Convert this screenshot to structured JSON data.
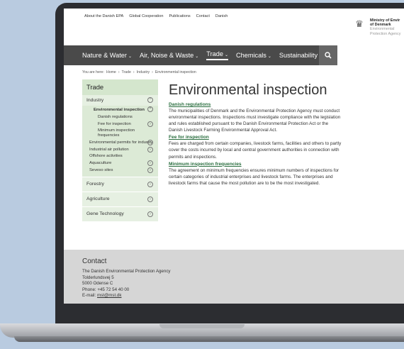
{
  "utility": {
    "links": [
      "About the Danish EPA",
      "Global Cooperation",
      "Publications",
      "Contact",
      "Danish"
    ]
  },
  "logo": {
    "line1": "Ministry of Envir",
    "line2": "of Denmark",
    "line3": "Environmental",
    "line4": "Protection Agency"
  },
  "nav": {
    "items": [
      {
        "label": "Nature & Water"
      },
      {
        "label": "Air, Noise & Waste"
      },
      {
        "label": "Trade"
      },
      {
        "label": "Chemicals"
      },
      {
        "label": "Sustainability"
      }
    ],
    "search_icon": "search-icon"
  },
  "breadcrumb": {
    "prefix": "You are here:",
    "items": [
      "Home",
      "Trade",
      "Industry",
      "Environmental inspection"
    ]
  },
  "sidebar": {
    "title": "Trade",
    "industry": "Industry",
    "sub": [
      {
        "label": "Environmental inspection"
      },
      {
        "label": "Danish regulations"
      },
      {
        "label": "Fee for inspection"
      },
      {
        "label": "Minimum inspection frequencies"
      },
      {
        "label": "Environmental permits for industry"
      },
      {
        "label": "Industrial air pollution"
      },
      {
        "label": "Offshore activities"
      },
      {
        "label": "Aquaculture"
      },
      {
        "label": "Seveso sites"
      }
    ],
    "sections": [
      "Forestry",
      "Agriculture",
      "Gene Technology"
    ]
  },
  "article": {
    "title": "Environmental inspection",
    "sections": [
      {
        "heading": "Danish regulations",
        "text": "The municipalities of Denmark and the Environmental Protection Agency must conduct environmental inspections. Inspections must investigate compliance with the legislation and rules established pursuant to the Danish Environmental Protection Act or the Danish Livestock Farming Environmental Approval Act."
      },
      {
        "heading": "Fee for inspection",
        "text": "Fees are charged from certain companies, livestock farms, facilities and others to partly cover the costs incurred by local and central government authorities in connection with permits and inspections."
      },
      {
        "heading": "Minimum inspection frequencies",
        "text": "The agreement on minimum frequencies ensures minimum numbers of inspections for certain categories of industrial enterprises and livestock farms. The enterprises and livestock farms that cause the most pollution are to be the most investigated."
      }
    ]
  },
  "footer": {
    "title": "Contact",
    "org": "The Danish Environmental Protection Agency",
    "street": "Tolderlundsvej 5",
    "city": "5000 Odense C",
    "phone": "Phone: +45 72 54 40 00",
    "email_label": "E-mail:",
    "email": "mst@mst.dk"
  },
  "colors": {
    "nav_bg": "#4a4a4a",
    "sidebar_head": "#d4e6cd",
    "sidebar_bg": "#e6f0e2",
    "link_green": "#2a6e3f",
    "footer_bg": "#d6d6d6"
  }
}
